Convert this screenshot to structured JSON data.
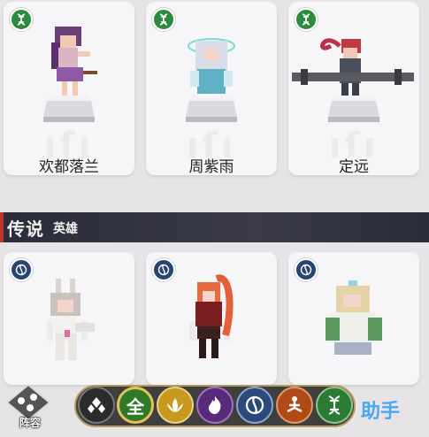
{
  "colors": {
    "dna_badge": "#2e8a3e",
    "water_badge": "#27456e",
    "all_filter": "#2f7a2a",
    "lotus_filter": "#c79a1e",
    "fire_filter": "#5a2a7a",
    "water_filter": "#2a4a7a",
    "meditate_filter": "#b04a16",
    "dna_filter": "#2c7a33"
  },
  "top_row": [
    {
      "name": "欢都落兰",
      "badge": "dna-icon"
    },
    {
      "name": "周紫雨",
      "badge": "dna-icon"
    },
    {
      "name": "定远",
      "badge": "dna-icon"
    }
  ],
  "section": {
    "title_main": "传说",
    "title_sub": "英雄"
  },
  "bottom_row": [
    {
      "name": "",
      "badge": "water-swirl-icon"
    },
    {
      "name": "",
      "badge": "water-swirl-icon"
    },
    {
      "name": "",
      "badge": "water-swirl-icon"
    }
  ],
  "toolbar": {
    "lineup_label": "阵容",
    "all_label": "全",
    "filters": [
      "diamond-filter-icon",
      "all-filter",
      "lotus-icon",
      "fire-icon",
      "water-swirl-icon",
      "meditate-icon",
      "dna-icon"
    ]
  },
  "watermark": "助手"
}
